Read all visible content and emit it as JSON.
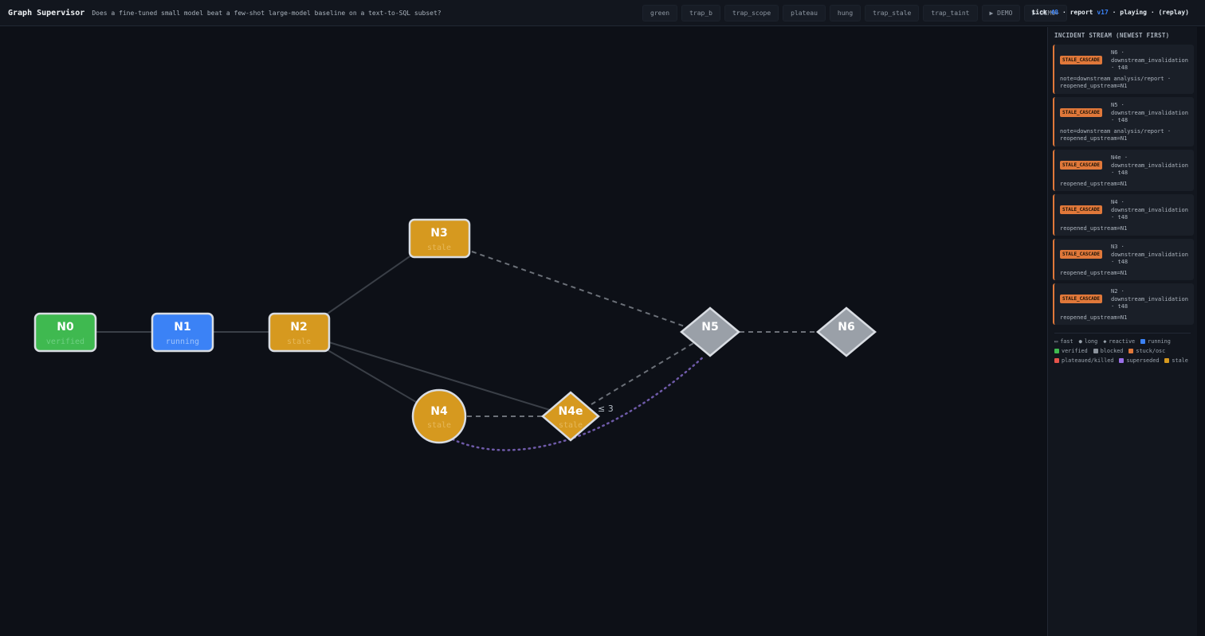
{
  "header": {
    "title": "Graph Supervisor",
    "question": "Does a fine-tuned small model beat a few-shot large-model baseline on a text-to-SQL subset?",
    "scenarios": [
      "green",
      "trap_b",
      "trap_scope",
      "plateau",
      "hung",
      "trap_stale",
      "trap_taint",
      "▶ DEMO",
      "▶ DEMO+"
    ],
    "status": {
      "tick_label": "tick",
      "tick": "48",
      "sep1": "·",
      "report_label": "report",
      "report": "v17",
      "sep2": "·",
      "state": "playing",
      "sep3": "·",
      "mode": "(replay)"
    }
  },
  "graph": {
    "nodes": [
      {
        "id": "N0",
        "status": "verified",
        "shape": "rect",
        "color": "#3fb950"
      },
      {
        "id": "N1",
        "status": "running",
        "shape": "rect",
        "color": "#3b82f6"
      },
      {
        "id": "N2",
        "status": "stale",
        "shape": "rect",
        "color": "#d6991f"
      },
      {
        "id": "N3",
        "status": "stale",
        "shape": "rect",
        "color": "#d6991f"
      },
      {
        "id": "N4",
        "status": "stale",
        "shape": "circle",
        "color": "#d6991f"
      },
      {
        "id": "N4e",
        "status": "stale",
        "shape": "diamond",
        "color": "#d6991f"
      },
      {
        "id": "N5",
        "status": "",
        "shape": "diamond",
        "color": "#9aa0a8"
      },
      {
        "id": "N6",
        "status": "",
        "shape": "diamond",
        "color": "#9aa0a8"
      }
    ],
    "edge_label": "≤ 3"
  },
  "sidebar": {
    "title": "INCIDENT STREAM (NEWEST FIRST)",
    "incidents": [
      {
        "badge": "STALE_CASCADE",
        "node": "N6",
        "kind": "downstream_invalidation",
        "tick": "t48",
        "note": "note=downstream analysis/report · reopened_upstream=N1"
      },
      {
        "badge": "STALE_CASCADE",
        "node": "N5",
        "kind": "downstream_invalidation",
        "tick": "t48",
        "note": "note=downstream analysis/report · reopened_upstream=N1"
      },
      {
        "badge": "STALE_CASCADE",
        "node": "N4e",
        "kind": "downstream_invalidation",
        "tick": "t48",
        "note": "reopened_upstream=N1"
      },
      {
        "badge": "STALE_CASCADE",
        "node": "N4",
        "kind": "downstream_invalidation",
        "tick": "t48",
        "note": "reopened_upstream=N1"
      },
      {
        "badge": "STALE_CASCADE",
        "node": "N3",
        "kind": "downstream_invalidation",
        "tick": "t48",
        "note": "reopened_upstream=N1"
      },
      {
        "badge": "STALE_CASCADE",
        "node": "N2",
        "kind": "downstream_invalidation",
        "tick": "t48",
        "note": "reopened_upstream=N1"
      }
    ],
    "legend": [
      {
        "label": "fast",
        "glyph": "▭"
      },
      {
        "label": "long",
        "glyph": "●"
      },
      {
        "label": "reactive",
        "glyph": "◆"
      },
      {
        "label": "running",
        "color": "#3b82f6"
      },
      {
        "label": "verified",
        "color": "#3fb950"
      },
      {
        "label": "blocked",
        "color": "#8b929b"
      },
      {
        "label": "stuck/osc",
        "color": "#e0783a"
      },
      {
        "label": "plateaued/killed",
        "color": "#e5534b"
      },
      {
        "label": "superseded",
        "color": "#9a6fe8"
      },
      {
        "label": "stale",
        "color": "#d6991f"
      }
    ]
  }
}
